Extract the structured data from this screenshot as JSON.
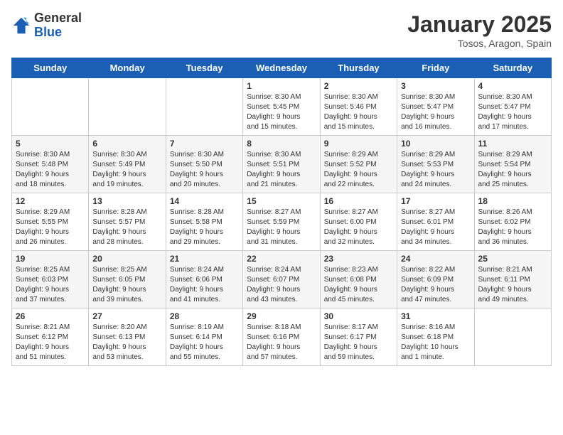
{
  "logo": {
    "general": "General",
    "blue": "Blue"
  },
  "header": {
    "title": "January 2025",
    "subtitle": "Tosos, Aragon, Spain"
  },
  "weekdays": [
    "Sunday",
    "Monday",
    "Tuesday",
    "Wednesday",
    "Thursday",
    "Friday",
    "Saturday"
  ],
  "weeks": [
    [
      {
        "day": "",
        "content": ""
      },
      {
        "day": "",
        "content": ""
      },
      {
        "day": "",
        "content": ""
      },
      {
        "day": "1",
        "content": "Sunrise: 8:30 AM\nSunset: 5:45 PM\nDaylight: 9 hours\nand 15 minutes."
      },
      {
        "day": "2",
        "content": "Sunrise: 8:30 AM\nSunset: 5:46 PM\nDaylight: 9 hours\nand 15 minutes."
      },
      {
        "day": "3",
        "content": "Sunrise: 8:30 AM\nSunset: 5:47 PM\nDaylight: 9 hours\nand 16 minutes."
      },
      {
        "day": "4",
        "content": "Sunrise: 8:30 AM\nSunset: 5:47 PM\nDaylight: 9 hours\nand 17 minutes."
      }
    ],
    [
      {
        "day": "5",
        "content": "Sunrise: 8:30 AM\nSunset: 5:48 PM\nDaylight: 9 hours\nand 18 minutes."
      },
      {
        "day": "6",
        "content": "Sunrise: 8:30 AM\nSunset: 5:49 PM\nDaylight: 9 hours\nand 19 minutes."
      },
      {
        "day": "7",
        "content": "Sunrise: 8:30 AM\nSunset: 5:50 PM\nDaylight: 9 hours\nand 20 minutes."
      },
      {
        "day": "8",
        "content": "Sunrise: 8:30 AM\nSunset: 5:51 PM\nDaylight: 9 hours\nand 21 minutes."
      },
      {
        "day": "9",
        "content": "Sunrise: 8:29 AM\nSunset: 5:52 PM\nDaylight: 9 hours\nand 22 minutes."
      },
      {
        "day": "10",
        "content": "Sunrise: 8:29 AM\nSunset: 5:53 PM\nDaylight: 9 hours\nand 24 minutes."
      },
      {
        "day": "11",
        "content": "Sunrise: 8:29 AM\nSunset: 5:54 PM\nDaylight: 9 hours\nand 25 minutes."
      }
    ],
    [
      {
        "day": "12",
        "content": "Sunrise: 8:29 AM\nSunset: 5:55 PM\nDaylight: 9 hours\nand 26 minutes."
      },
      {
        "day": "13",
        "content": "Sunrise: 8:28 AM\nSunset: 5:57 PM\nDaylight: 9 hours\nand 28 minutes."
      },
      {
        "day": "14",
        "content": "Sunrise: 8:28 AM\nSunset: 5:58 PM\nDaylight: 9 hours\nand 29 minutes."
      },
      {
        "day": "15",
        "content": "Sunrise: 8:27 AM\nSunset: 5:59 PM\nDaylight: 9 hours\nand 31 minutes."
      },
      {
        "day": "16",
        "content": "Sunrise: 8:27 AM\nSunset: 6:00 PM\nDaylight: 9 hours\nand 32 minutes."
      },
      {
        "day": "17",
        "content": "Sunrise: 8:27 AM\nSunset: 6:01 PM\nDaylight: 9 hours\nand 34 minutes."
      },
      {
        "day": "18",
        "content": "Sunrise: 8:26 AM\nSunset: 6:02 PM\nDaylight: 9 hours\nand 36 minutes."
      }
    ],
    [
      {
        "day": "19",
        "content": "Sunrise: 8:25 AM\nSunset: 6:03 PM\nDaylight: 9 hours\nand 37 minutes."
      },
      {
        "day": "20",
        "content": "Sunrise: 8:25 AM\nSunset: 6:05 PM\nDaylight: 9 hours\nand 39 minutes."
      },
      {
        "day": "21",
        "content": "Sunrise: 8:24 AM\nSunset: 6:06 PM\nDaylight: 9 hours\nand 41 minutes."
      },
      {
        "day": "22",
        "content": "Sunrise: 8:24 AM\nSunset: 6:07 PM\nDaylight: 9 hours\nand 43 minutes."
      },
      {
        "day": "23",
        "content": "Sunrise: 8:23 AM\nSunset: 6:08 PM\nDaylight: 9 hours\nand 45 minutes."
      },
      {
        "day": "24",
        "content": "Sunrise: 8:22 AM\nSunset: 6:09 PM\nDaylight: 9 hours\nand 47 minutes."
      },
      {
        "day": "25",
        "content": "Sunrise: 8:21 AM\nSunset: 6:11 PM\nDaylight: 9 hours\nand 49 minutes."
      }
    ],
    [
      {
        "day": "26",
        "content": "Sunrise: 8:21 AM\nSunset: 6:12 PM\nDaylight: 9 hours\nand 51 minutes."
      },
      {
        "day": "27",
        "content": "Sunrise: 8:20 AM\nSunset: 6:13 PM\nDaylight: 9 hours\nand 53 minutes."
      },
      {
        "day": "28",
        "content": "Sunrise: 8:19 AM\nSunset: 6:14 PM\nDaylight: 9 hours\nand 55 minutes."
      },
      {
        "day": "29",
        "content": "Sunrise: 8:18 AM\nSunset: 6:16 PM\nDaylight: 9 hours\nand 57 minutes."
      },
      {
        "day": "30",
        "content": "Sunrise: 8:17 AM\nSunset: 6:17 PM\nDaylight: 9 hours\nand 59 minutes."
      },
      {
        "day": "31",
        "content": "Sunrise: 8:16 AM\nSunset: 6:18 PM\nDaylight: 10 hours\nand 1 minute."
      },
      {
        "day": "",
        "content": ""
      }
    ]
  ]
}
